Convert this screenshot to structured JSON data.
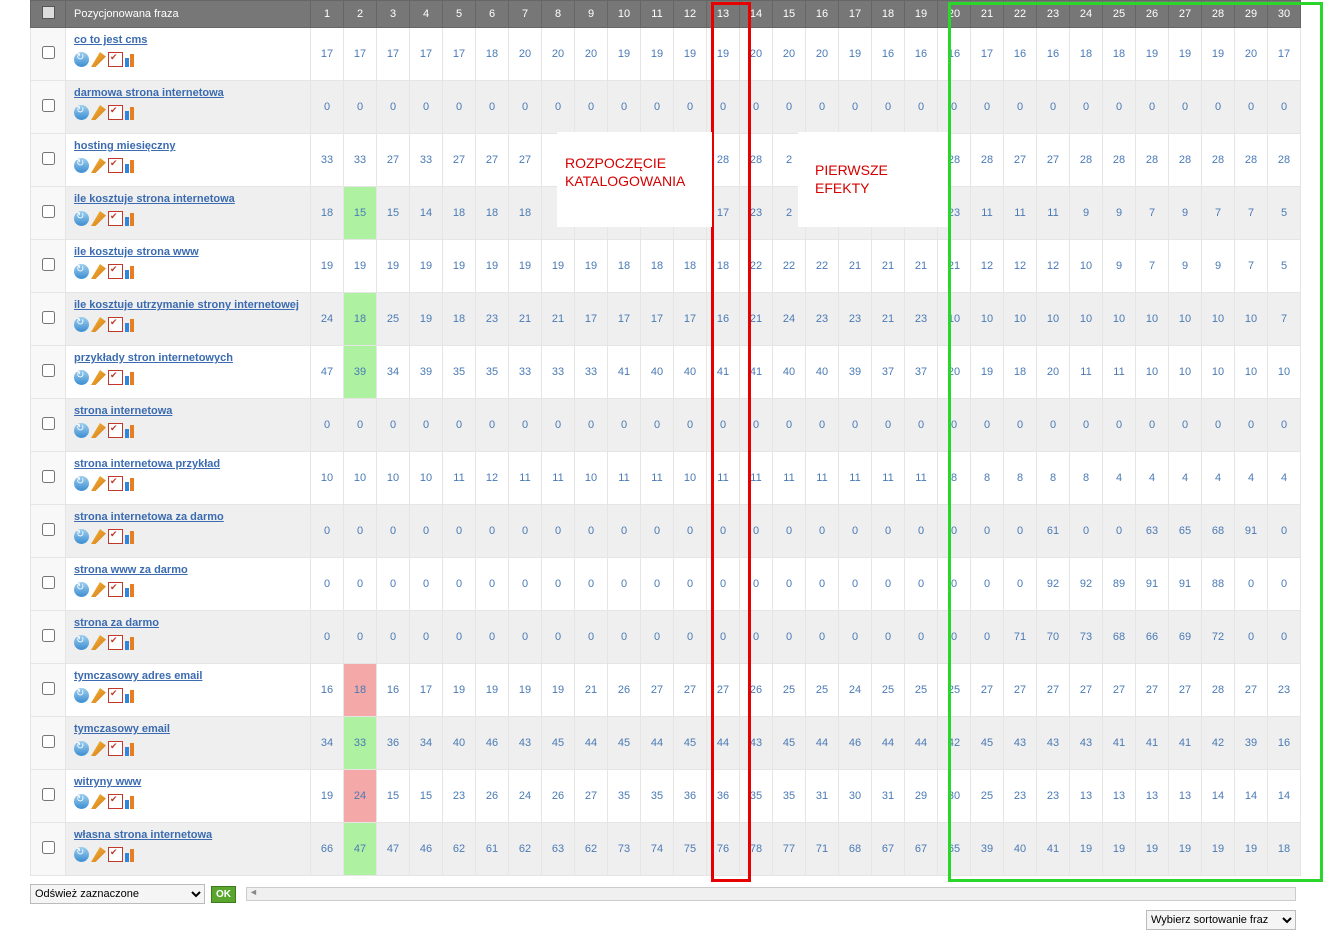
{
  "header": {
    "phrase_col": "Pozycjonowana fraza",
    "days": [
      "1",
      "2",
      "3",
      "4",
      "5",
      "6",
      "7",
      "8",
      "9",
      "10",
      "11",
      "12",
      "13",
      "14",
      "15",
      "16",
      "17",
      "18",
      "19",
      "20",
      "21",
      "22",
      "23",
      "24",
      "25",
      "26",
      "27",
      "28",
      "29",
      "30"
    ]
  },
  "annotations": {
    "label1_line1": "ROZPOCZĘCIE",
    "label1_line2": "KATALOGOWANIA",
    "label2_line1": "PIERWSZE",
    "label2_line2": "EFEKTY"
  },
  "footer": {
    "refresh_selected": "Odśwież zaznaczone",
    "ok": "OK",
    "sort_placeholder": "Wybierz sortowanie fraz"
  },
  "columns_highlight": {
    "green": {
      "col": 2,
      "rows": [
        4,
        6,
        7,
        14,
        16
      ]
    },
    "red": {
      "col": 2,
      "rows": [
        13,
        15
      ]
    }
  },
  "rows": [
    {
      "phrase": "co to jest cms",
      "vals": [
        "17",
        "17",
        "17",
        "17",
        "17",
        "18",
        "20",
        "20",
        "20",
        "19",
        "19",
        "19",
        "19",
        "20",
        "20",
        "20",
        "19",
        "16",
        "16",
        "16",
        "17",
        "16",
        "16",
        "18",
        "18",
        "19",
        "19",
        "19",
        "20",
        "17"
      ]
    },
    {
      "phrase": "darmowa strona internetowa",
      "vals": [
        "0",
        "0",
        "0",
        "0",
        "0",
        "0",
        "0",
        "0",
        "0",
        "0",
        "0",
        "0",
        "0",
        "0",
        "0",
        "0",
        "0",
        "0",
        "0",
        "0",
        "0",
        "0",
        "0",
        "0",
        "0",
        "0",
        "0",
        "0",
        "0",
        "0"
      ]
    },
    {
      "phrase": "hosting miesięczny",
      "vals": [
        "33",
        "33",
        "27",
        "33",
        "27",
        "27",
        "27",
        "",
        "",
        "",
        "",
        "",
        "28",
        "28",
        "2",
        "",
        "",
        "",
        "",
        "28",
        "28",
        "27",
        "27",
        "28",
        "28",
        "28",
        "28",
        "28",
        "28",
        "28"
      ]
    },
    {
      "phrase": "ile kosztuje strona internetowa",
      "vals": [
        "18",
        "15",
        "15",
        "14",
        "18",
        "18",
        "18",
        "",
        "",
        "",
        "",
        "",
        "17",
        "23",
        "2",
        "",
        "",
        "",
        "",
        "23",
        "11",
        "11",
        "11",
        "9",
        "9",
        "7",
        "9",
        "7",
        "7",
        "5"
      ]
    },
    {
      "phrase": "ile kosztuje strona www",
      "vals": [
        "19",
        "19",
        "19",
        "19",
        "19",
        "19",
        "19",
        "19",
        "19",
        "18",
        "18",
        "18",
        "18",
        "22",
        "22",
        "22",
        "21",
        "21",
        "21",
        "21",
        "12",
        "12",
        "12",
        "10",
        "9",
        "7",
        "9",
        "9",
        "7",
        "5"
      ]
    },
    {
      "phrase": "ile kosztuje utrzymanie strony internetowej",
      "vals": [
        "24",
        "18",
        "25",
        "19",
        "18",
        "23",
        "21",
        "21",
        "17",
        "17",
        "17",
        "17",
        "16",
        "21",
        "24",
        "23",
        "23",
        "21",
        "23",
        "10",
        "10",
        "10",
        "10",
        "10",
        "10",
        "10",
        "10",
        "10",
        "10",
        "7"
      ]
    },
    {
      "phrase": "przykłady stron internetowych",
      "vals": [
        "47",
        "39",
        "34",
        "39",
        "35",
        "35",
        "33",
        "33",
        "33",
        "41",
        "40",
        "40",
        "41",
        "41",
        "40",
        "40",
        "39",
        "37",
        "37",
        "20",
        "19",
        "18",
        "20",
        "11",
        "11",
        "10",
        "10",
        "10",
        "10",
        "10"
      ]
    },
    {
      "phrase": "strona internetowa",
      "vals": [
        "0",
        "0",
        "0",
        "0",
        "0",
        "0",
        "0",
        "0",
        "0",
        "0",
        "0",
        "0",
        "0",
        "0",
        "0",
        "0",
        "0",
        "0",
        "0",
        "0",
        "0",
        "0",
        "0",
        "0",
        "0",
        "0",
        "0",
        "0",
        "0",
        "0"
      ]
    },
    {
      "phrase": "strona internetowa przykład",
      "vals": [
        "10",
        "10",
        "10",
        "10",
        "11",
        "12",
        "11",
        "11",
        "10",
        "11",
        "11",
        "10",
        "11",
        "11",
        "11",
        "11",
        "11",
        "11",
        "11",
        "8",
        "8",
        "8",
        "8",
        "8",
        "4",
        "4",
        "4",
        "4",
        "4",
        "4"
      ]
    },
    {
      "phrase": "strona internetowa za darmo",
      "vals": [
        "0",
        "0",
        "0",
        "0",
        "0",
        "0",
        "0",
        "0",
        "0",
        "0",
        "0",
        "0",
        "0",
        "0",
        "0",
        "0",
        "0",
        "0",
        "0",
        "0",
        "0",
        "0",
        "61",
        "0",
        "0",
        "63",
        "65",
        "68",
        "91",
        "0"
      ]
    },
    {
      "phrase": "strona www za darmo",
      "vals": [
        "0",
        "0",
        "0",
        "0",
        "0",
        "0",
        "0",
        "0",
        "0",
        "0",
        "0",
        "0",
        "0",
        "0",
        "0",
        "0",
        "0",
        "0",
        "0",
        "0",
        "0",
        "0",
        "92",
        "92",
        "89",
        "91",
        "91",
        "88",
        "0",
        "0"
      ]
    },
    {
      "phrase": "strona za darmo",
      "vals": [
        "0",
        "0",
        "0",
        "0",
        "0",
        "0",
        "0",
        "0",
        "0",
        "0",
        "0",
        "0",
        "0",
        "0",
        "0",
        "0",
        "0",
        "0",
        "0",
        "0",
        "0",
        "71",
        "70",
        "73",
        "68",
        "66",
        "69",
        "72",
        "0",
        "0"
      ]
    },
    {
      "phrase": "tymczasowy adres email",
      "vals": [
        "16",
        "18",
        "16",
        "17",
        "19",
        "19",
        "19",
        "19",
        "21",
        "26",
        "27",
        "27",
        "27",
        "26",
        "25",
        "25",
        "24",
        "25",
        "25",
        "25",
        "27",
        "27",
        "27",
        "27",
        "27",
        "27",
        "27",
        "28",
        "27",
        "23"
      ]
    },
    {
      "phrase": "tymczasowy email",
      "vals": [
        "34",
        "33",
        "36",
        "34",
        "40",
        "46",
        "43",
        "45",
        "44",
        "45",
        "44",
        "45",
        "44",
        "43",
        "45",
        "44",
        "46",
        "44",
        "44",
        "42",
        "45",
        "43",
        "43",
        "43",
        "41",
        "41",
        "41",
        "42",
        "39",
        "16"
      ]
    },
    {
      "phrase": "witryny www",
      "vals": [
        "19",
        "24",
        "15",
        "15",
        "23",
        "26",
        "24",
        "26",
        "27",
        "35",
        "35",
        "36",
        "36",
        "35",
        "35",
        "31",
        "30",
        "31",
        "29",
        "30",
        "25",
        "23",
        "23",
        "13",
        "13",
        "13",
        "13",
        "14",
        "14",
        "14"
      ]
    },
    {
      "phrase": "własna strona internetowa",
      "vals": [
        "66",
        "47",
        "47",
        "46",
        "62",
        "61",
        "62",
        "63",
        "62",
        "73",
        "74",
        "75",
        "76",
        "78",
        "77",
        "71",
        "68",
        "67",
        "67",
        "65",
        "39",
        "40",
        "41",
        "19",
        "19",
        "19",
        "19",
        "19",
        "19",
        "18"
      ]
    }
  ]
}
